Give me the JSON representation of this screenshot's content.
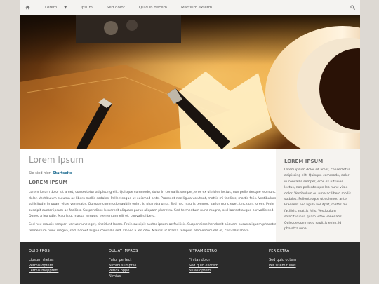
{
  "nav": {
    "items": [
      {
        "label": "Lorem",
        "has_caret": true
      },
      {
        "label": "Ipsum"
      },
      {
        "label": "Sed dolor"
      },
      {
        "label": "Quid in decem"
      },
      {
        "label": "Martium exterm"
      }
    ]
  },
  "main": {
    "title": "Lorem Ipsum",
    "breadcrumb_prefix": "Sie sind hier:",
    "breadcrumb_link": "Startseite",
    "section_title": "LOREM IPSUM",
    "paragraphs": [
      "Lorem ipsum dolor sit amet, consectetur adipiscing elit. Quisque commodo, dolor in convallis semper, eros ex ultricies lectus, non pellentesque leo nunc vitae dolor. Vestibulum eu urna ac libero mollis sodales. Pellentesque ut euismod ante. Praesent nec ligula volutpat, mattis mi facilisis, mattis felis. Vestibulum sollicitudin in quam vitae venenatis. Quisque commodo sagittis enim, id pharetra urna. Sed nec mauris tempor, varius nunc eget, tincidunt lorem. Proin suscipit auctor ipsum ac facilisis. Suspendisse hendrerit aliquam purus aliquam pharetra. Sed fermentum nunc magna, sed laoreet augue convallis sed. Donec a leo odio. Mauris ut massa tempus, elementum elit et, convallis libero.",
      "Sed nec mauris tempor, varius nunc eget, tincidunt lorem. Proin suscipit auctor ipsum ac facilisis. Suspendisse hendrerit aliquam purus aliquam pharetra. Sed fermentum nunc magna, sed laoreet augue convallis sed. Donec a leo odio. Mauris ut massa tempus, elementum elit et, convallis libero."
    ]
  },
  "sidebar": {
    "title": "LOREM IPSUM",
    "text": "Lorem ipsum dolor sit amet, consectetur adipiscing elit. Quisque commodo, dolor in convallis semper, eros ex ultricies lectus, non pellentesque leo nunc vitae dolor. Vestibulum eu urna ac libero mollis sodales. Pellentesque ut euismod ante. Praesent nec ligula volutpat, mattis mi facilisis, mattis felis. Vestibulum sollicitudin in quam vitae venenatis. Quisque commodo sagittis enim, id pharetra urna."
  },
  "footer": {
    "columns": [
      {
        "heading": "QUID PROS",
        "links": [
          "Lipsum rhetus",
          "Permis optem",
          "Lermis mepptem"
        ]
      },
      {
        "heading": "QULIAT IMPROS",
        "links": [
          "Futur perfect",
          "Nimmus impras",
          "Perlox oppo",
          "Nimius"
        ]
      },
      {
        "heading": "NITRAM EXTRO",
        "links": [
          "Finitas dolor",
          "Sed quid exctem",
          "Nillas optem"
        ]
      },
      {
        "heading": "PER EXTRA",
        "links": [
          "Sed quid octem",
          "Per sitem tulios"
        ]
      }
    ]
  },
  "colors": {
    "link": "#1b6a8f",
    "footer_bg": "#2b2b2b",
    "sidebar_bg": "#f5f3f0",
    "page_bg": "#ddd9d3"
  },
  "icons": {
    "home": "home-icon",
    "search": "search-icon",
    "caret": "caret-down-icon"
  }
}
